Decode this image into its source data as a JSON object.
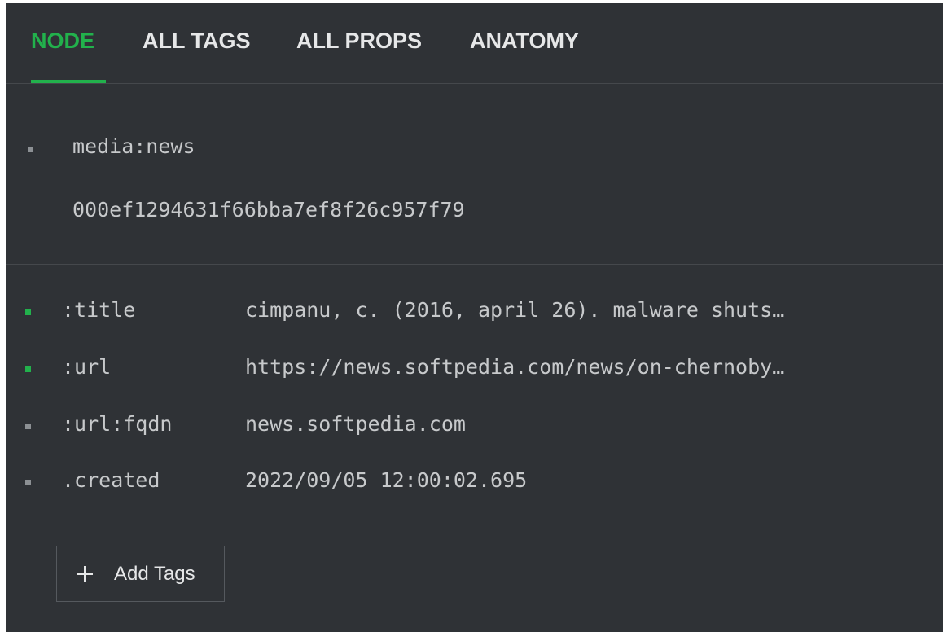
{
  "tabs": [
    {
      "label": "NODE",
      "active": true
    },
    {
      "label": "ALL TAGS",
      "active": false
    },
    {
      "label": "ALL PROPS",
      "active": false
    },
    {
      "label": "ANATOMY",
      "active": false
    }
  ],
  "node": {
    "form": "media:news",
    "iden": "000ef1294631f66bba7ef8f26c957f79"
  },
  "props": [
    {
      "name": ":title",
      "value": "cimpanu, c. (2016, april 26). malware shuts…",
      "bullet": "green"
    },
    {
      "name": ":url",
      "value": "https://news.softpedia.com/news/on-chernoby…",
      "bullet": "green"
    },
    {
      "name": ":url:fqdn",
      "value": "news.softpedia.com",
      "bullet": "gray"
    },
    {
      "name": ".created",
      "value": "2022/09/05 12:00:02.695",
      "bullet": "gray"
    }
  ],
  "actions": {
    "add_tags_label": "Add Tags"
  },
  "colors": {
    "background": "#2f3236",
    "accent": "#22b14c",
    "text": "#c7c9cb",
    "divider": "#45484c"
  }
}
